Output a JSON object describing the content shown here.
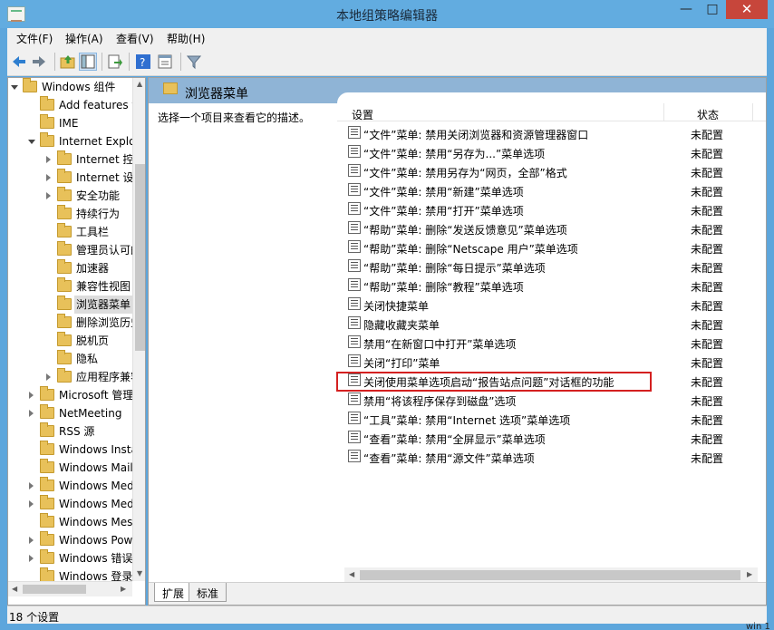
{
  "window": {
    "title": "本地组策略编辑器",
    "minimize": "—",
    "maximize": "□",
    "close": "✕"
  },
  "menu": [
    {
      "label": "文件(F)"
    },
    {
      "label": "操作(A)"
    },
    {
      "label": "查看(V)"
    },
    {
      "label": "帮助(H)"
    }
  ],
  "toolbar": [
    {
      "icon": "back-arrow-icon"
    },
    {
      "icon": "forward-arrow-icon"
    },
    {
      "icon": "folder-up-icon"
    },
    {
      "icon": "show-hide-tree-icon"
    },
    {
      "icon": "export-list-icon"
    },
    {
      "icon": "help-icon"
    },
    {
      "icon": "properties-icon"
    },
    {
      "icon": "filter-icon"
    }
  ],
  "tree": {
    "items": [
      {
        "label": "Windows 组件",
        "expander": "open"
      },
      {
        "label": "Add features t",
        "expander": "none"
      },
      {
        "label": "IME",
        "expander": "none"
      },
      {
        "label": "Internet Explor",
        "expander": "open"
      },
      {
        "label": "Internet 控制",
        "expander": "closed"
      },
      {
        "label": "Internet 设置",
        "expander": "closed"
      },
      {
        "label": "安全功能",
        "expander": "closed"
      },
      {
        "label": "持续行为",
        "expander": "none"
      },
      {
        "label": "工具栏",
        "expander": "none"
      },
      {
        "label": "管理员认可的",
        "expander": "none"
      },
      {
        "label": "加速器",
        "expander": "none"
      },
      {
        "label": "兼容性视图",
        "expander": "none"
      },
      {
        "label": "浏览器菜单",
        "expander": "none",
        "selected": true
      },
      {
        "label": "删除浏览历史",
        "expander": "none"
      },
      {
        "label": "脱机页",
        "expander": "none"
      },
      {
        "label": "隐私",
        "expander": "none"
      },
      {
        "label": "应用程序兼容",
        "expander": "closed"
      },
      {
        "label": "Microsoft 管理",
        "expander": "closed"
      },
      {
        "label": "NetMeeting",
        "expander": "closed"
      },
      {
        "label": "RSS 源",
        "expander": "none"
      },
      {
        "label": "Windows Insta",
        "expander": "none"
      },
      {
        "label": "Windows Mail",
        "expander": "none"
      },
      {
        "label": "Windows Med",
        "expander": "closed"
      },
      {
        "label": "Windows Med",
        "expander": "closed"
      },
      {
        "label": "Windows Mess",
        "expander": "none"
      },
      {
        "label": "Windows Powe",
        "expander": "closed"
      },
      {
        "label": "Windows 错误报",
        "expander": "closed"
      },
      {
        "label": "Windows 登录选",
        "expander": "none"
      }
    ]
  },
  "panel": {
    "title": "浏览器菜单",
    "description": "选择一个项目来查看它的描述。",
    "columns": {
      "setting": "设置",
      "state": "状态"
    },
    "rows": [
      {
        "name": "“文件”菜单: 禁用关闭浏览器和资源管理器窗口",
        "state": "未配置"
      },
      {
        "name": "“文件”菜单: 禁用“另存为...”菜单选项",
        "state": "未配置"
      },
      {
        "name": "“文件”菜单: 禁用另存为“网页，全部”格式",
        "state": "未配置"
      },
      {
        "name": "“文件”菜单: 禁用“新建”菜单选项",
        "state": "未配置"
      },
      {
        "name": "“文件”菜单: 禁用“打开”菜单选项",
        "state": "未配置"
      },
      {
        "name": "“帮助”菜单: 删除“发送反馈意见”菜单选项",
        "state": "未配置"
      },
      {
        "name": "“帮助”菜单: 删除“Netscape 用户”菜单选项",
        "state": "未配置"
      },
      {
        "name": "“帮助”菜单: 删除“每日提示”菜单选项",
        "state": "未配置"
      },
      {
        "name": "“帮助”菜单: 删除“教程”菜单选项",
        "state": "未配置"
      },
      {
        "name": "关闭快捷菜单",
        "state": "未配置"
      },
      {
        "name": "隐藏收藏夹菜单",
        "state": "未配置"
      },
      {
        "name": "禁用“在新窗口中打开”菜单选项",
        "state": "未配置"
      },
      {
        "name": "关闭“打印”菜单",
        "state": "未配置"
      },
      {
        "name": "关闭使用菜单选项启动“报告站点问题”对话框的功能",
        "state": "未配置",
        "highlighted": true
      },
      {
        "name": "禁用“将该程序保存到磁盘”选项",
        "state": "未配置"
      },
      {
        "name": "“工具”菜单: 禁用“Internet 选项”菜单选项",
        "state": "未配置"
      },
      {
        "name": "“查看”菜单: 禁用“全屏显示”菜单选项",
        "state": "未配置"
      },
      {
        "name": "“查看”菜单: 禁用“源文件”菜单选项",
        "state": "未配置"
      }
    ],
    "tabs": [
      {
        "label": "扩展"
      },
      {
        "label": "标准"
      }
    ]
  },
  "status": {
    "text": "18 个设置"
  },
  "background_fragment": "win 1"
}
